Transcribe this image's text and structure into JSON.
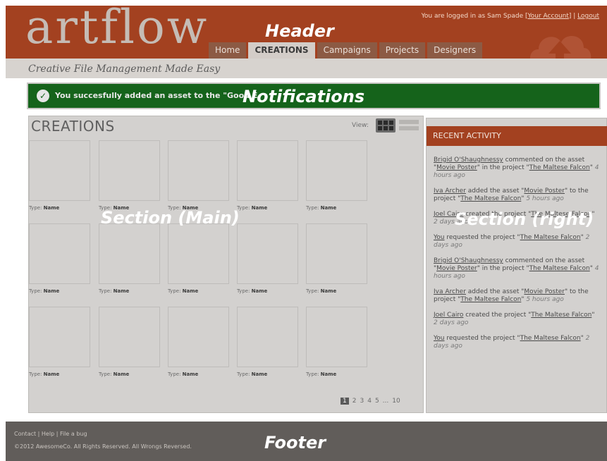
{
  "brand": {
    "logo": "artflow",
    "tagline": "Creative File Management Made Easy"
  },
  "header": {
    "overlay_label": "Header",
    "login": {
      "prefix": "You are logged in as Sam Spade [",
      "account": "Your Account",
      "sep": "] | ",
      "logout": "Logout"
    },
    "tabs": [
      {
        "label": "Home",
        "active": false
      },
      {
        "label": "CREATIONS",
        "active": true
      },
      {
        "label": "Campaigns",
        "active": false
      },
      {
        "label": "Projects",
        "active": false
      },
      {
        "label": "Designers",
        "active": false
      }
    ]
  },
  "notification": {
    "text": "You succesfully added an asset to the \"Good E",
    "overlay_label": "Notifications"
  },
  "main": {
    "title": "CREATIONS",
    "view_label": "View:",
    "overlay_label": "Section (Main)",
    "thumb_caption": {
      "type_label": "Type:",
      "name_label": "Name"
    },
    "pagination": [
      "1",
      "2",
      "3",
      "4",
      "5",
      "...",
      "10"
    ]
  },
  "recent": {
    "title": "RECENT ACTIVITY",
    "overlay_label": "Section (right)",
    "items": [
      {
        "user": "Brigid O'Shaughnessy",
        "action": " commented on the asset \"",
        "asset": "Movie Poster",
        "mid": "\" in the project \"",
        "project": "The Maltese Falcon",
        "end": "\"",
        "time": "4 hours ago"
      },
      {
        "user": "Iva Archer",
        "action": " added the asset \"",
        "asset": "Movie Poster",
        "mid": "\" to the project \"",
        "project": "The Maltese Falcon",
        "end": "\"",
        "time": "5 hours ago"
      },
      {
        "user": "Joel Cairo",
        "action": " created the project \"",
        "asset": "",
        "mid": "",
        "project": "The Maltese Falcon",
        "end": "\"",
        "time": "2 days ago"
      },
      {
        "user": "You",
        "action": " requested the project \"",
        "asset": "",
        "mid": "",
        "project": "The Maltese Falcon",
        "end": "\"",
        "time": "2 days ago"
      },
      {
        "user": "Brigid O'Shaughnessy",
        "action": " commented on the asset \"",
        "asset": "Movie Poster",
        "mid": "\" in the project \"",
        "project": "The Maltese Falcon",
        "end": "\"",
        "time": "4 hours ago"
      },
      {
        "user": "Iva Archer",
        "action": " added the asset \"",
        "asset": "Movie Poster",
        "mid": "\" to the project \"",
        "project": "The Maltese Falcon",
        "end": "\"",
        "time": "5 hours ago"
      },
      {
        "user": "Joel Cairo",
        "action": " created the project \"",
        "asset": "",
        "mid": "",
        "project": "The Maltese Falcon",
        "end": "\"",
        "time": "2 days ago"
      },
      {
        "user": "You",
        "action": " requested the project \"",
        "asset": "",
        "mid": "",
        "project": "The Maltese Falcon",
        "end": "\"",
        "time": "2 days ago"
      }
    ]
  },
  "footer": {
    "links": [
      "Contact",
      "Help",
      "File a bug"
    ],
    "copyright": "©2012 AwesomeCo. All Rights Reserved. All Wrongs Reversed.",
    "overlay_label": "Footer"
  },
  "colors": {
    "brand": "#a34120",
    "success": "#15631b",
    "footer": "#615d5a",
    "panel": "#d3d1cf"
  }
}
